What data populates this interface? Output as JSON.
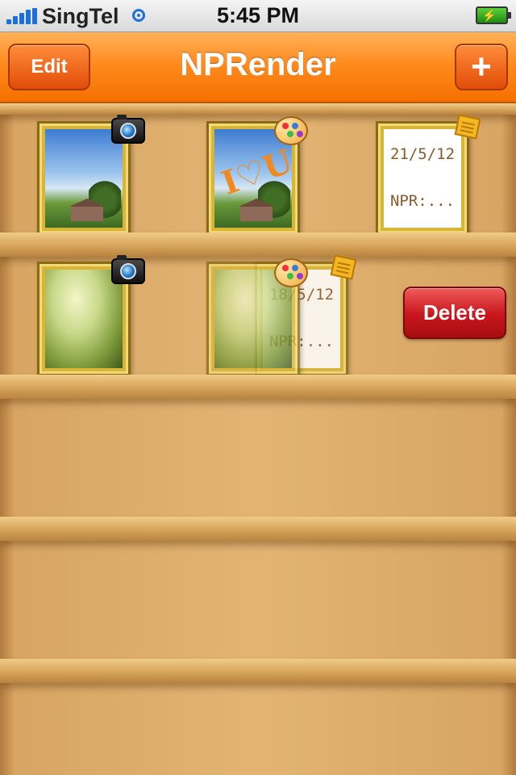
{
  "status_bar": {
    "carrier": "SingTel",
    "time": "5:45 PM",
    "icons": [
      "signal-bars-icon",
      "wifi-icon",
      "battery-charging-icon"
    ]
  },
  "nav_bar": {
    "title": "NPRender",
    "edit_label": "Edit",
    "add_label": "+"
  },
  "shelf": {
    "rows": [
      {
        "items": [
          {
            "type": "photo",
            "badge": "camera-icon"
          },
          {
            "type": "painting",
            "badge": "palette-icon"
          },
          {
            "type": "note",
            "badge": "notepad-icon",
            "date": "21/5/12",
            "text": "NPR:..."
          }
        ]
      },
      {
        "items": [
          {
            "type": "photo",
            "badge": "camera-icon"
          },
          {
            "type": "painting",
            "badge": "palette-icon"
          },
          {
            "type": "note",
            "badge": "notepad-icon",
            "date": "18/5/12",
            "text": "NPR:..."
          }
        ]
      }
    ],
    "delete_label": "Delete"
  },
  "colors": {
    "nav_orange": "#f56f00",
    "button_orange": "#e14c08",
    "delete_red": "#c8161c",
    "frame_gold": "#d9b537"
  }
}
